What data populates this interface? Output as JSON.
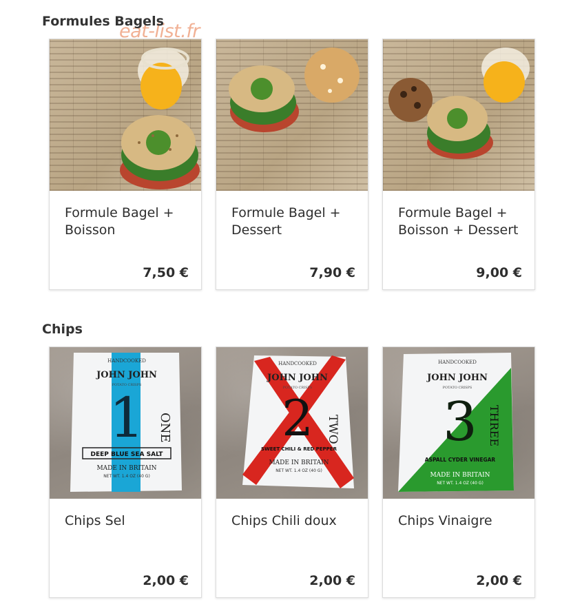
{
  "watermark": "eat-list.fr",
  "sections": [
    {
      "title": "Formules Bagels",
      "items": [
        {
          "name": "Formule Bagel + Boisson",
          "price": "7,50 €",
          "image": "bagel-with-orange-juice-photo"
        },
        {
          "name": "Formule Bagel + Dessert",
          "price": "7,90 €",
          "image": "bagel-with-cookie-photo"
        },
        {
          "name": "Formule Bagel + Boisson + Dessert",
          "price": "9,00 €",
          "image": "bagel-with-juice-and-cookie-photo"
        }
      ]
    },
    {
      "title": "Chips",
      "items": [
        {
          "name": "Chips Sel",
          "price": "2,00 €",
          "image": "chips-bag-blue-photo",
          "bag": {
            "brand": "JOHN JOHN",
            "top": "HANDCOOKED",
            "sub": "POTATO CRISPS",
            "number": "1",
            "word": "ONE",
            "flavor": "DEEP BLUE SEA SALT",
            "made": "MADE IN BRITAIN",
            "net": "NET WT. 1.4 OZ (40 G)"
          }
        },
        {
          "name": "Chips Chili doux",
          "price": "2,00 €",
          "image": "chips-bag-red-photo",
          "bag": {
            "brand": "JOHN JOHN",
            "top": "HANDCOOKED",
            "sub": "POTATO CRISPS",
            "number": "2",
            "word": "TWO",
            "flavor": "SWEET CHILI & RED PEPPER",
            "made": "MADE IN BRITAIN",
            "net": "NET WT. 1.4 OZ (40 G)"
          }
        },
        {
          "name": "Chips Vinaigre",
          "price": "2,00 €",
          "image": "chips-bag-green-photo",
          "bag": {
            "brand": "JOHN JOHN",
            "top": "HANDCOOKED",
            "sub": "POTATO CRISPS",
            "number": "3",
            "word": "THREE",
            "flavor": "ASPALL CYDER VINEGAR",
            "made": "MADE IN BRITAIN",
            "net": "NET WT. 1.4 OZ (40 G)"
          }
        }
      ]
    }
  ],
  "colors": {
    "blue": "#1aa6d6",
    "red": "#d8261f",
    "green": "#2a9a2e",
    "juice": "#f6b21b"
  }
}
